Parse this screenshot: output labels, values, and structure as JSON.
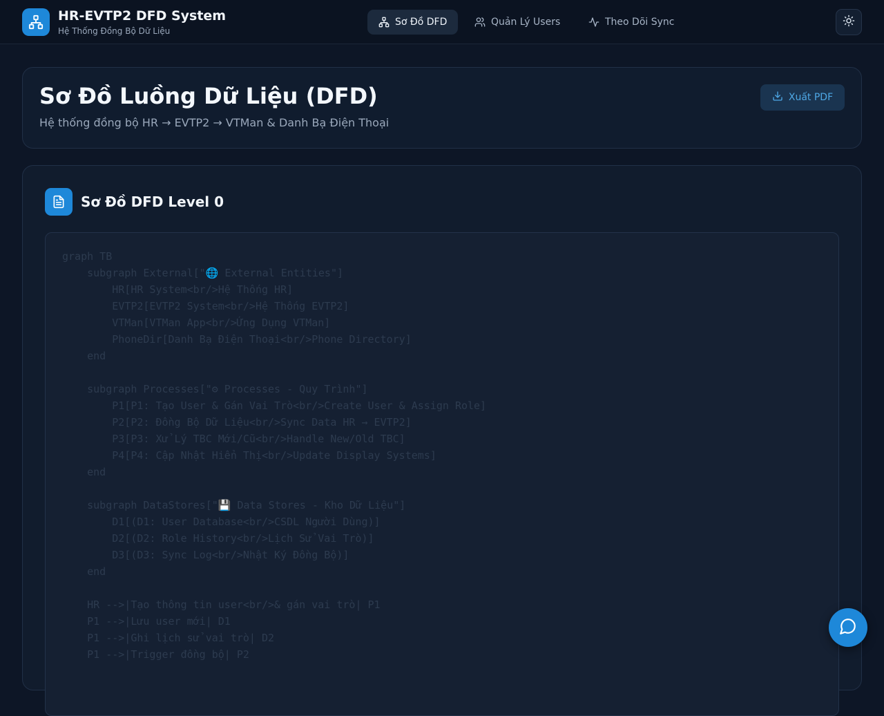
{
  "app": {
    "title": "HR-EVTP2 DFD System",
    "subtitle": "Hệ Thống Đồng Bộ Dữ Liệu"
  },
  "nav": {
    "items": [
      {
        "label": "Sơ Đồ DFD",
        "icon": "network-icon",
        "active": true
      },
      {
        "label": "Quản Lý Users",
        "icon": "users-icon",
        "active": false
      },
      {
        "label": "Theo Dõi Sync",
        "icon": "activity-icon",
        "active": false
      }
    ]
  },
  "theme_toggle_icon": "sun-icon",
  "header": {
    "title": "Sơ Đồ Luồng Dữ Liệu (DFD)",
    "subtitle": "Hệ thống đồng bộ HR → EVTP2 → VTMan & Danh Bạ Điện Thoại",
    "export_label": "Xuất PDF",
    "export_icon": "download-icon"
  },
  "diagram": {
    "title": "Sơ Đồ DFD Level 0",
    "icon": "document-icon",
    "code_lines": [
      "graph TB",
      "    subgraph External[\"🌐 External Entities\"]",
      "        HR[HR System<br/>Hệ Thống HR]",
      "        EVTP2[EVTP2 System<br/>Hệ Thống EVTP2]",
      "        VTMan[VTMan App<br/>Ứng Dụng VTMan]",
      "        PhoneDir[Danh Bạ Điện Thoại<br/>Phone Directory]",
      "    end",
      "",
      "    subgraph Processes[\"⚙ Processes - Quy Trình\"]",
      "        P1[P1: Tạo User & Gán Vai Trò<br/>Create User & Assign Role]",
      "        P2[P2: Đồng Bộ Dữ Liệu<br/>Sync Data HR → EVTP2]",
      "        P3[P3: Xử Lý TBC Mới/Cũ<br/>Handle New/Old TBC]",
      "        P4[P4: Cập Nhật Hiển Thị<br/>Update Display Systems]",
      "    end",
      "",
      "    subgraph DataStores[\"💾 Data Stores - Kho Dữ Liệu\"]",
      "        D1[(D1: User Database<br/>CSDL Người Dùng)]",
      "        D2[(D2: Role History<br/>Lịch Sử Vai Trò)]",
      "        D3[(D3: Sync Log<br/>Nhật Ký Đồng Bộ)]",
      "    end",
      "",
      "    HR -->|Tạo thông tin user<br/>& gán vai trò| P1",
      "    P1 -->|Lưu user mới| D1",
      "    P1 -->|Ghi lịch sử vai trò| D2",
      "    P1 -->|Trigger đồng bộ| P2"
    ]
  },
  "chat_icon": "chat-bubble-icon",
  "colors": {
    "accent": "#1e88d9",
    "background": "#0d1626",
    "card": "#111c2d",
    "code_text": "#2d3b4f"
  }
}
